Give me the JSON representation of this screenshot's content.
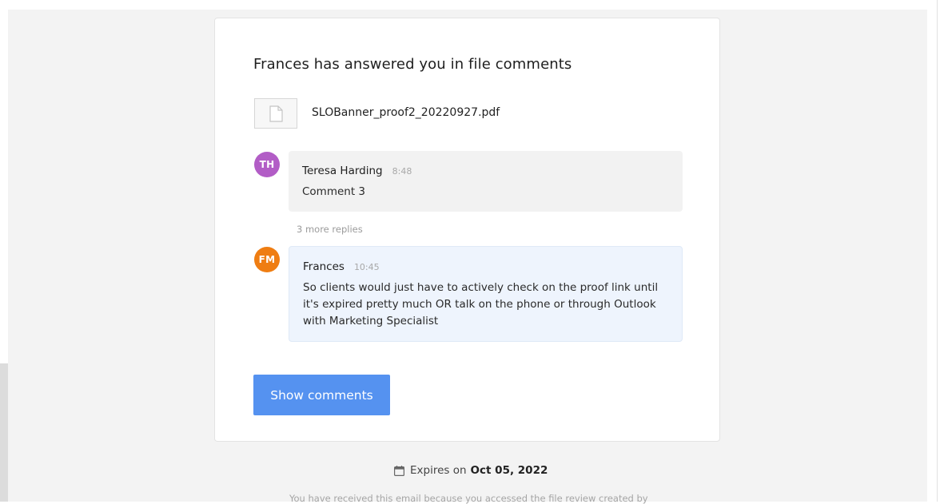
{
  "email": {
    "heading": "Frances has answered you in file comments",
    "file": {
      "icon": "document-icon",
      "name": "SLOBanner_proof2_20220927.pdf"
    },
    "comments": [
      {
        "initials": "TH",
        "avatar_color": "#b25dc6",
        "author": "Teresa Harding",
        "time": "8:48",
        "text": "Comment 3"
      },
      {
        "initials": "FM",
        "avatar_color": "#ef7d12",
        "author": "Frances",
        "time": "10:45",
        "text": "So clients would just have to actively check on the proof link until it's expired pretty much OR talk on the phone or through Outlook with Marketing Specialist"
      }
    ],
    "more_replies": "3 more replies",
    "show_comments_label": "Show comments",
    "expires": {
      "icon": "calendar-icon",
      "prefix": "Expires on",
      "date": "Oct 05, 2022"
    },
    "footer_note": "You have received this email because you accessed the file review created by"
  },
  "colors": {
    "accent": "#5592f0",
    "reply_bubble": "#eef4fd",
    "comment_bubble": "#f2f2f2"
  }
}
